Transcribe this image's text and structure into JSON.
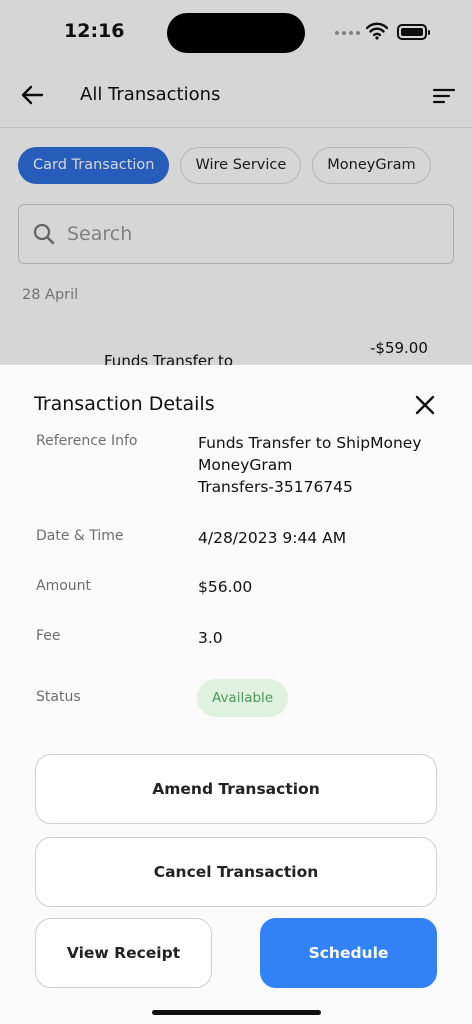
{
  "status_bar": {
    "time": "12:16"
  },
  "header": {
    "title": "All Transactions"
  },
  "filters": [
    {
      "label": "Card Transaction",
      "active": true
    },
    {
      "label": "Wire Service",
      "active": false
    },
    {
      "label": "MoneyGram",
      "active": false
    }
  ],
  "search": {
    "placeholder": "Search"
  },
  "list": {
    "date": "28 April",
    "transaction": {
      "name": "Funds Transfer to",
      "amount": "-$59.00"
    }
  },
  "sheet": {
    "title": "Transaction Details",
    "reference": {
      "label": "Reference Info",
      "line1": "Funds Transfer to ShipMoney",
      "line2": "MoneyGram",
      "line3": "Transfers-35176745"
    },
    "datetime": {
      "label": "Date & Time",
      "value": "4/28/2023 9:44 AM"
    },
    "amount": {
      "label": "Amount",
      "value": "$56.00"
    },
    "fee": {
      "label": "Fee",
      "value": "3.0"
    },
    "status": {
      "label": "Status",
      "value": "Available"
    },
    "buttons": {
      "amend": "Amend Transaction",
      "cancel": "Cancel Transaction",
      "receipt": "View Receipt",
      "schedule": "Schedule"
    }
  },
  "colors": {
    "accent": "#3281f6",
    "chip_active": "#2f6fde",
    "status_bg": "#dff1df",
    "status_text": "#4a9a55"
  },
  "icons": {
    "back": "arrow-left-icon",
    "filter": "sort-lines-icon",
    "search": "search-icon",
    "close": "close-icon"
  }
}
